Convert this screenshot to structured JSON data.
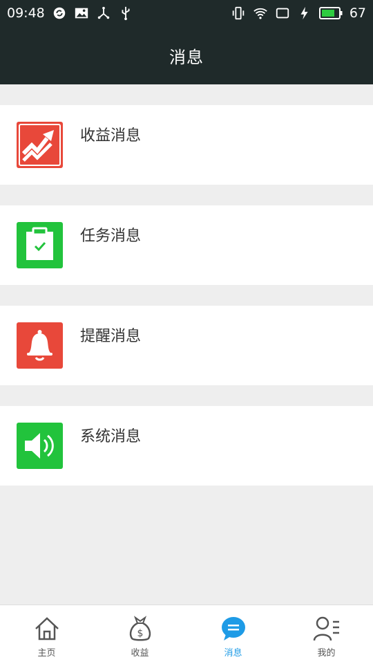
{
  "status_bar": {
    "time": "09:48",
    "battery": "67",
    "left_icons": [
      "sync-icon",
      "image-icon",
      "share-icon",
      "usb-icon"
    ],
    "right_icons": [
      "vibrate-icon",
      "wifi-icon",
      "screen-icon",
      "charging-icon",
      "battery-icon"
    ]
  },
  "app_bar": {
    "title": "消息"
  },
  "messages": {
    "items": [
      {
        "label": "收益消息",
        "icon": "earnings-chart-icon",
        "color": "#e8483a"
      },
      {
        "label": "任务消息",
        "icon": "task-clipboard-icon",
        "color": "#22c33c"
      },
      {
        "label": "提醒消息",
        "icon": "bell-icon",
        "color": "#e8483a"
      },
      {
        "label": "系统消息",
        "icon": "speaker-icon",
        "color": "#22c33c"
      }
    ]
  },
  "bottom_nav": {
    "active_color": "#1e9be6",
    "items": [
      {
        "label": "主页",
        "icon": "home-icon",
        "active": false
      },
      {
        "label": "收益",
        "icon": "money-bag-icon",
        "active": false
      },
      {
        "label": "消息",
        "icon": "chat-bubble-icon",
        "active": true
      },
      {
        "label": "我的",
        "icon": "profile-icon",
        "active": false
      }
    ]
  }
}
